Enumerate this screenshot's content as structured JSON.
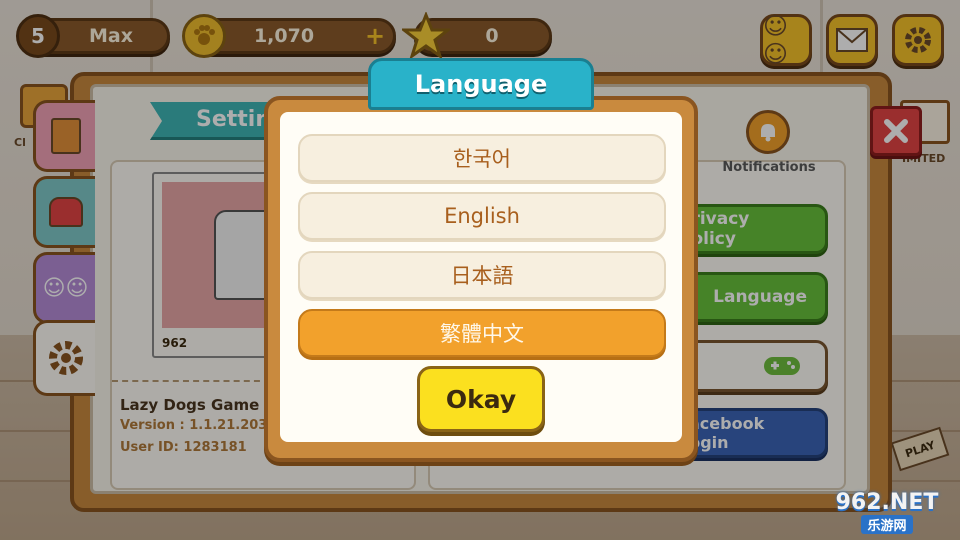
{
  "hud": {
    "level": "5",
    "player_name": "Max",
    "coins": "1,070",
    "stars": "0"
  },
  "settings": {
    "title": "Settings",
    "profile_number": "962",
    "game_name": "Lazy Dogs Game",
    "version": "Version : 1.1.21.203",
    "user_id": "User ID: 1283181",
    "notifications_label": "Notifications",
    "privacy_label": "Privacy Policy",
    "language_label": "Language",
    "facebook_label": "Facebook Login",
    "side_label_left": "Cl",
    "side_label_right": "IMITED"
  },
  "language_modal": {
    "title": "Language",
    "options": [
      "한국어",
      "English",
      "日本語",
      "繁體中文"
    ],
    "selected_index": 3,
    "okay_label": "Okay"
  },
  "watermark": {
    "line1": "962.NET",
    "line2": "乐游网"
  },
  "colors": {
    "modal_title_bg": "#29b2c9",
    "selected_option": "#f2a12c",
    "okay_button": "#fbe01f",
    "green_button": "#68c23c",
    "facebook_button": "#3b65b7",
    "close_button": "#e44545"
  }
}
